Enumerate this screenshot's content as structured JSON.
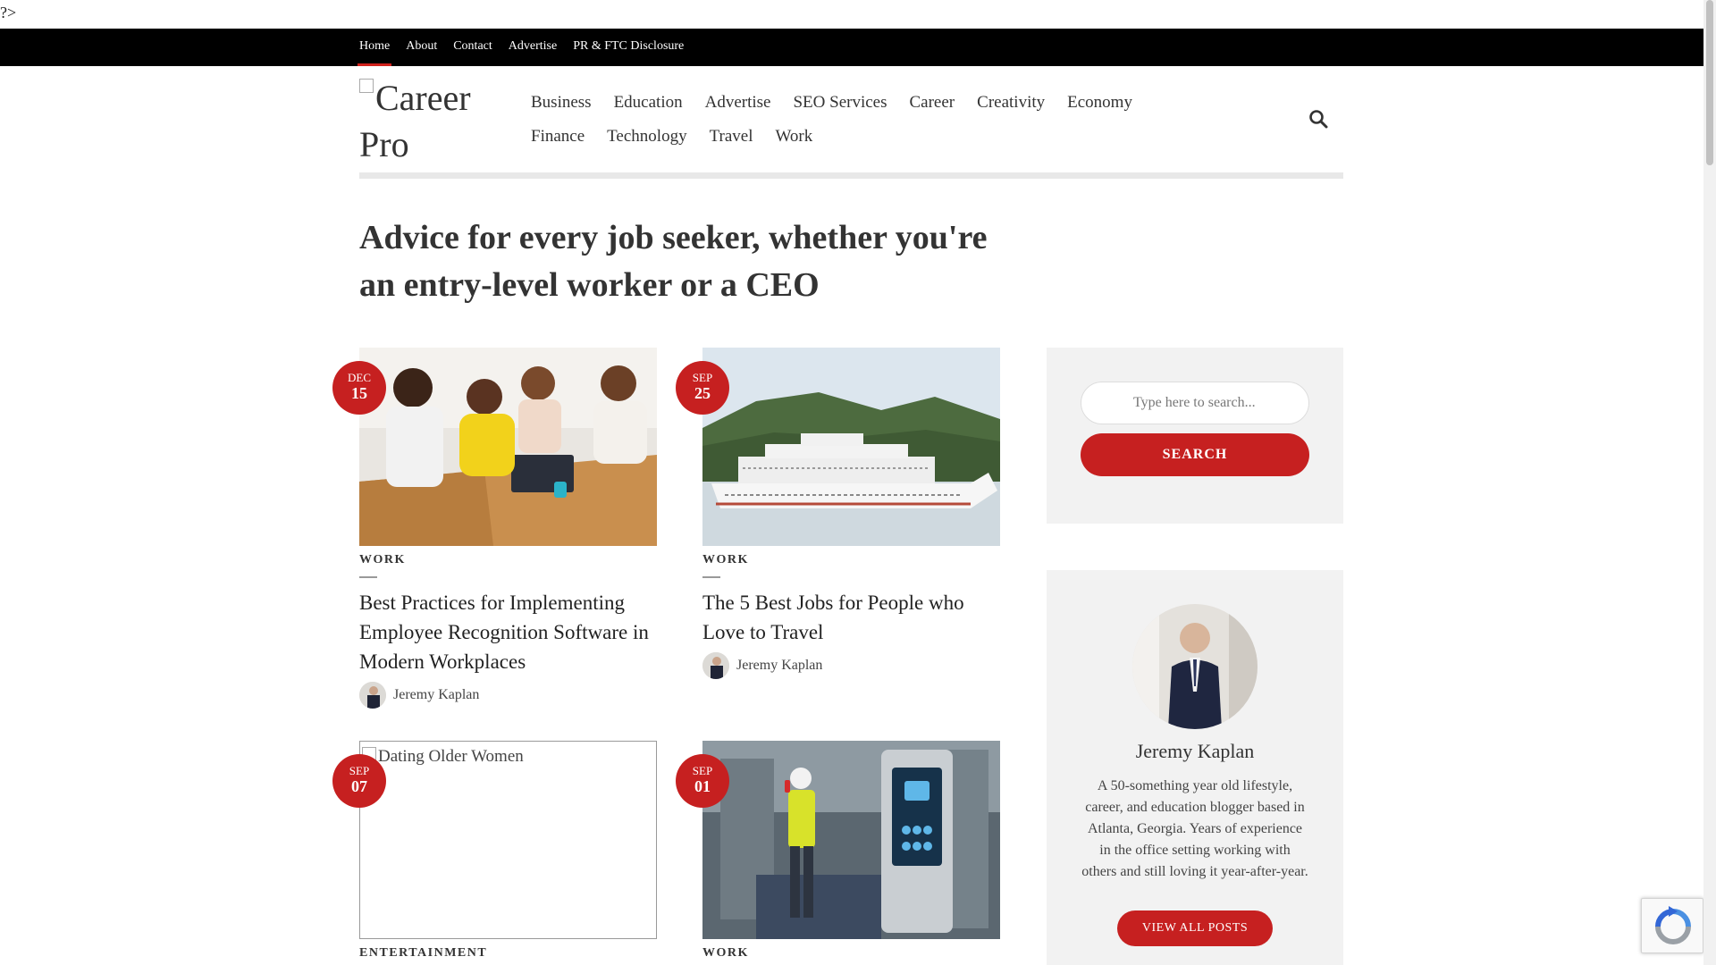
{
  "artifact": "?>",
  "topbar": {
    "items": [
      {
        "label": "Home"
      },
      {
        "label": "About"
      },
      {
        "label": "Contact"
      },
      {
        "label": "Advertise"
      },
      {
        "label": "PR & FTC Disclosure"
      }
    ]
  },
  "logo": {
    "alt": "Career Pro"
  },
  "mainnav": {
    "items": [
      {
        "label": "Business"
      },
      {
        "label": "Education"
      },
      {
        "label": "Advertise"
      },
      {
        "label": "SEO Services"
      },
      {
        "label": "Career"
      },
      {
        "label": "Creativity"
      },
      {
        "label": "Economy"
      },
      {
        "label": "Finance"
      },
      {
        "label": "Technology"
      },
      {
        "label": "Travel"
      },
      {
        "label": "Work"
      }
    ]
  },
  "tagline": "Advice for every job seeker, whether you're an entry-level worker or a CEO",
  "posts": [
    {
      "month": "DEC",
      "day": "15",
      "category": "WORK",
      "title": "Best Practices for Implementing Employee Recognition Software in Modern Workplaces",
      "author": "Jeremy Kaplan"
    },
    {
      "month": "SEP",
      "day": "25",
      "category": "WORK",
      "title": "The 5 Best Jobs for People who Love to Travel",
      "author": "Jeremy Kaplan"
    },
    {
      "month": "SEP",
      "day": "07",
      "category": "ENTERTAINMENT",
      "image_alt": "Dating Older Women"
    },
    {
      "month": "SEP",
      "day": "01",
      "category": "WORK"
    }
  ],
  "sidebar": {
    "search": {
      "placeholder": "Type here to search...",
      "button": "SEARCH"
    },
    "author": {
      "name": "Jeremy Kaplan",
      "bio": "A 50-something year old lifestyle, career, and education blogger based in Atlanta, Georgia. Years of experience in the office setting working with others and still loving it year-after-year.",
      "button": "VIEW ALL POSTS"
    }
  },
  "colors": {
    "accent": "#c62020",
    "topbar": "#000000",
    "widget_bg": "#f2f2f2"
  }
}
